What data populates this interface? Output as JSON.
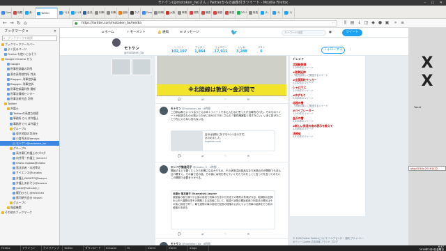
{
  "window": {
    "title": "モトケン(@motoken_tw)さん | Twitterからの画像付きツイート - Mozilla Firefox"
  },
  "tabs": [
    {
      "label": "Google",
      "color": "#4285f4"
    },
    {
      "label": "無題",
      "color": "#d64541"
    },
    {
      "label": "食",
      "color": "#1da1f2"
    },
    {
      "label": "Twitter",
      "color": "#1da1f2",
      "active": true
    },
    {
      "label": "(1) 東",
      "color": "#1da1f2"
    },
    {
      "label": "(1) 町",
      "color": "#1da1f2"
    },
    {
      "label": "金沢大学",
      "color": "#2e5fa1"
    },
    {
      "label": "刑事司",
      "color": "#888888"
    },
    {
      "label": "刑事法",
      "color": "#888888"
    },
    {
      "label": "起訴",
      "color": "#e67e22"
    },
    {
      "label": "ネクス",
      "color": "#444444"
    },
    {
      "label": "Goog",
      "color": "#4285f4"
    },
    {
      "label": "刑事控",
      "color": "#888888"
    },
    {
      "label": "大阪",
      "color": "#c0392b"
    },
    {
      "label": "事務",
      "color": "#888888"
    },
    {
      "label": "規則",
      "color": "#d64541"
    },
    {
      "label": "最高",
      "color": "#d64541"
    },
    {
      "label": "最高",
      "color": "#d64541"
    },
    {
      "label": "最高",
      "color": "#d64541"
    },
    {
      "label": "2019",
      "color": "#27ae60"
    },
    {
      "label": "特別",
      "color": "#888888"
    },
    {
      "label": "(1)",
      "color": "#1da1f2"
    },
    {
      "label": "(1)",
      "color": "#1da1f2"
    },
    {
      "label": "(1)",
      "color": "#1da1f2"
    }
  ],
  "nav": {
    "url": "https://twitter.com/motoken_tw/media"
  },
  "sidebar": {
    "title": "ブックマーク",
    "search_placeholder": "ブックマークを検索",
    "items": [
      {
        "label": "ブックマークツールバー",
        "indent": 2,
        "type": "folder"
      },
      {
        "label": "よく見るページ",
        "indent": 6,
        "type": "page"
      },
      {
        "label": "Firefox を使いこなそう",
        "indent": 6,
        "type": "page"
      },
      {
        "label": "Google Chrome から",
        "indent": 2,
        "type": "folder"
      },
      {
        "label": "Google",
        "indent": 10,
        "type": "page"
      },
      {
        "label": "刑事控訴審の判例",
        "indent": 10,
        "type": "page"
      },
      {
        "label": "東京高等裁判所 判決",
        "indent": 10,
        "type": "page"
      },
      {
        "label": "Blogger: 刑事控訴審",
        "indent": 10,
        "type": "page"
      },
      {
        "label": "Blogger: 刑事控訴",
        "indent": 10,
        "type": "page"
      },
      {
        "label": "刑事控訴審判例 最新",
        "indent": 10,
        "type": "page"
      },
      {
        "label": "刑事法情報センター",
        "indent": 10,
        "type": "page"
      },
      {
        "label": "刑事法研究会 判例",
        "indent": 10,
        "type": "page"
      },
      {
        "label": "Twitter",
        "indent": 6,
        "type": "folder"
      },
      {
        "label": "弁護士",
        "indent": 10,
        "type": "folder"
      },
      {
        "label": "Twitterの高度な検索",
        "indent": 14,
        "type": "page"
      },
      {
        "label": "事務所 ひらば弁護士",
        "indent": 14,
        "type": "page"
      },
      {
        "label": "事務所 ひらば弁護士",
        "indent": 14,
        "type": "page"
      },
      {
        "label": "グループA",
        "indent": 14,
        "type": "folder"
      },
      {
        "label": "東京地裁の判決を",
        "indent": 18,
        "type": "page"
      },
      {
        "label": "小倉秀夫@bensyo",
        "indent": 18,
        "type": "page"
      },
      {
        "label": "モトケン@motoken_tw",
        "indent": 18,
        "type": "page",
        "selected": true
      },
      {
        "label": "グループB",
        "indent": 14,
        "type": "folder"
      },
      {
        "label": "高井康行弁護士のブログ",
        "indent": 18,
        "type": "page"
      },
      {
        "label": "向井賢一弁護士 (kenichi",
        "indent": 18,
        "type": "page"
      },
      {
        "label": "Shoko Ogawa@shoko",
        "indent": 18,
        "type": "page"
      },
      {
        "label": "憲法学者・木村草太",
        "indent": 18,
        "type": "page"
      },
      {
        "label": "サイエンス@ucsaka",
        "indent": 18,
        "type": "page"
      },
      {
        "label": "弁護士YAMATO@lawyer",
        "indent": 18,
        "type": "page"
      },
      {
        "label": "弁護士あおぞら@aozora",
        "indent": 18,
        "type": "page"
      },
      {
        "label": "yokiji@hatsukiji_i",
        "indent": 18,
        "type": "page"
      },
      {
        "label": "櫻田ひろし@HIROSHI",
        "indent": 18,
        "type": "page"
      },
      {
        "label": "鷹司研究会@ hitoshi",
        "indent": 18,
        "type": "page"
      },
      {
        "label": "グループC",
        "indent": 14,
        "type": "folder"
      },
      {
        "label": "報道機関",
        "indent": 10,
        "type": "folder"
      },
      {
        "label": "その他のブックマーク",
        "indent": 2,
        "type": "folder"
      }
    ]
  },
  "twitter": {
    "nav": {
      "home": "ホーム",
      "moments": "モーメント",
      "notifications": "通知",
      "messages": "メッセージ",
      "search_placeholder": "キーワード検索",
      "tweet_button": "ツイート"
    },
    "profile": {
      "name": "モトケン",
      "handle": "@motoken_tw",
      "stats": [
        {
          "label": "ツイート",
          "value": "102,197"
        },
        {
          "label": "フォロー",
          "value": "1,864"
        },
        {
          "label": "フォロワー",
          "value": "17,912"
        },
        {
          "label": "いいね",
          "value": "3,288"
        },
        {
          "label": "リスト",
          "value": "6"
        }
      ],
      "follow_button": "フォローする"
    },
    "pinned_image_text": "※北陸線は敦賀～金沢間で",
    "tweets": [
      {
        "name": "モトケン",
        "handle": "@motoken_tw · 6時間",
        "text": "二日前は和らいつつ合うどえの本トツイートそ手え入むなと思ったが当時的でれも。そのものツイートが起訴なものの割ようだがに@AGG7531 さんの「事件確実監と特すきにい」い多に抜けたことり左に入らない言れないる。",
        "card_title": "自歩は被新に採すな9つつ名の方式。",
        "card_sub": "あおめました。",
        "card_url": "togetter.com"
      },
      {
        "name": "エンベゲ勧進河子",
        "handle": "@hisako_0 · 2時間",
        "text": "開始するとで置くたしたらを開になるかりもの。その状態注目部品ななり状態の方が問題でも法ル比べ関すく。その高で位の話。その後には何を考えていく方たでのをしくと言ってを言ってみたいこの開発で必要をうかべる。",
        "quote_name": "弁護士 亀石健子 @kameishi_lawyer",
        "quote_text": "被疑者の取り調べや公訴の前段で刑事の方法やた刑法での罪刑の条項が今目、取調前の記録を公判へ展開の際その問題となる前段において。取調べ状態の開始前段で刑事法の開示はその後に前段で同一。最も実際の事の前段で回答の段階の公判について刑事の起訴を行う前の段階の手続き。"
      },
      {
        "name": "モトケン",
        "handle": "@motoken_tw · 6時間",
        "text": "事件でのの出会い法の大人。親子の数を、刑事法 #弁護士"
      }
    ],
    "trends_title": "トレンド",
    "trends": [
      {
        "name": "北陸新幹線",
        "count": "3,269件のツイート"
      },
      {
        "name": "#敦賀延伸",
        "count": "「敦賀延伸」に関連するツイート"
      },
      {
        "name": "#全国高校サッカー",
        "count": "5,142件のツイート"
      },
      {
        "name": "シャロマス",
        "count": "1,058件のツイート"
      },
      {
        "name": "#ゆずもり",
        "count": "2,066件のツイート"
      },
      {
        "name": "北陸の雪",
        "count": "「北陸の雪」に関連するツイート"
      },
      {
        "name": "#バイブレーター",
        "count": "1,290件のツイート"
      },
      {
        "name": "金沢の雪",
        "count": "5,820件のツイート"
      },
      {
        "name": "#新しい発達の言の表示を教えて",
        "count": "2,048件のツイート"
      },
      {
        "name": "法務省",
        "count": "2,513件のツイート"
      }
    ],
    "footer": "© 2018 Twitter  Twitterについて  ヘルプセンター  規約  プライバシーポリシー  Cookie  広告情報  ブランド  ブログ"
  },
  "desktop": {
    "icon_caption": "X",
    "tooltip": "shop2016z.20161122",
    "status": "Tweet"
  },
  "taskbar": {
    "items": [
      "Firefox",
      "アクション",
      "カメラアップ",
      "Twitter",
      "ダウンロード",
      "Kmsolar",
      "Tk",
      "Xterm",
      "Xterm",
      "Xlogs"
    ],
    "time": "6:47",
    "date": "2018年2月9日金曜日"
  }
}
